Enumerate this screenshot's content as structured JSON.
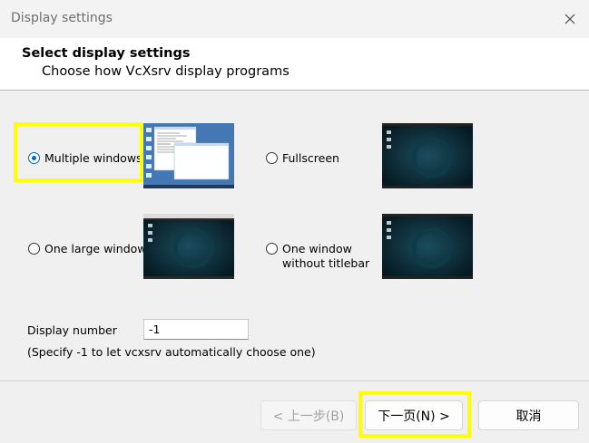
{
  "window": {
    "title": "Display settings",
    "close_icon": "close-icon"
  },
  "header": {
    "title": "Select display settings",
    "subtitle": "Choose how VcXsrv display programs"
  },
  "options": [
    {
      "id": "multiple",
      "label": "Multiple windows",
      "checked": true
    },
    {
      "id": "fullscreen",
      "label": "Fullscreen",
      "checked": false
    },
    {
      "id": "onelarge",
      "label": "One large window",
      "checked": false
    },
    {
      "id": "notitle",
      "label_line1": "One window",
      "label_line2": "without titlebar",
      "checked": false
    }
  ],
  "display_number": {
    "label": "Display number",
    "value": "-1",
    "hint": "(Specify -1 to let vcxsrv automatically choose one)"
  },
  "buttons": {
    "back": "< 上一步(B)",
    "next": "下一页(N) >",
    "cancel": "取消"
  },
  "colors": {
    "accent": "#0067c0",
    "highlight": "#ffff00",
    "thumb_bg": "#0a2a35"
  }
}
